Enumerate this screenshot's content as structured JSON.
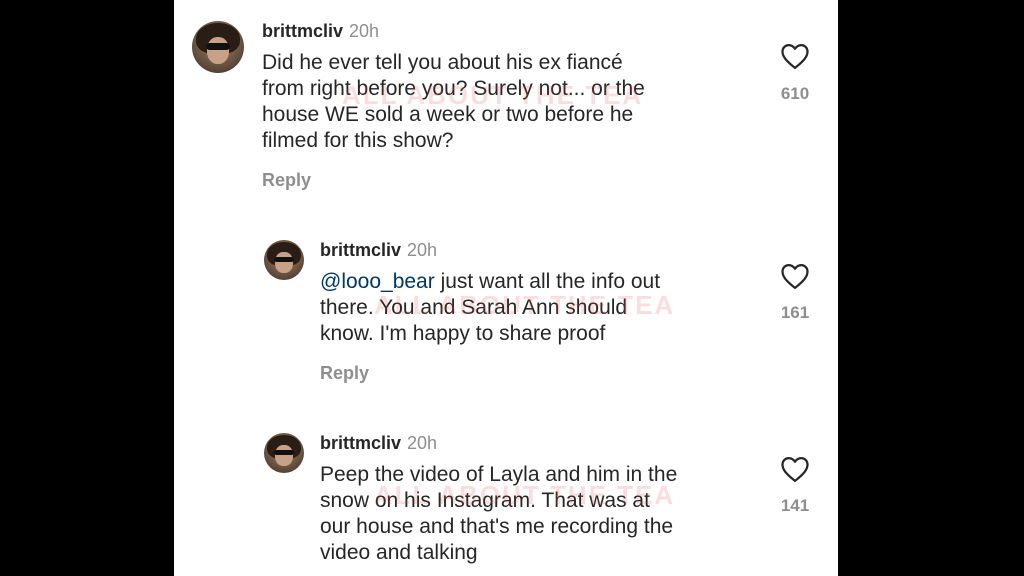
{
  "comments": [
    {
      "username": "brittmcliv",
      "time": "20h",
      "lines": [
        "Did he ever tell you about his ex fiancé",
        "from right before you? Surely not... or the",
        "house WE sold a week or two before he",
        "filmed for this show?"
      ],
      "reply_label": "Reply",
      "likes": "610",
      "icon": "heart-icon"
    },
    {
      "username": "brittmcliv",
      "time": "20h",
      "mention": "@looo_bear",
      "first_line_rest": " just want all the info out",
      "lines": [
        "there. You and Sarah Ann should",
        "know. I'm happy to share proof"
      ],
      "reply_label": "Reply",
      "likes": "161",
      "icon": "heart-icon"
    },
    {
      "username": "brittmcliv",
      "time": "20h",
      "lines": [
        "Peep the video of Layla and him in the",
        "snow on his Instagram. That was at",
        "our house and that's me recording the",
        "video and talking"
      ],
      "likes": "141",
      "icon": "heart-icon"
    }
  ],
  "watermark": "ALL ABOUT THE TEA",
  "colors": {
    "mention": "#00376b",
    "text": "#262626",
    "muted": "#8e8e8e"
  }
}
